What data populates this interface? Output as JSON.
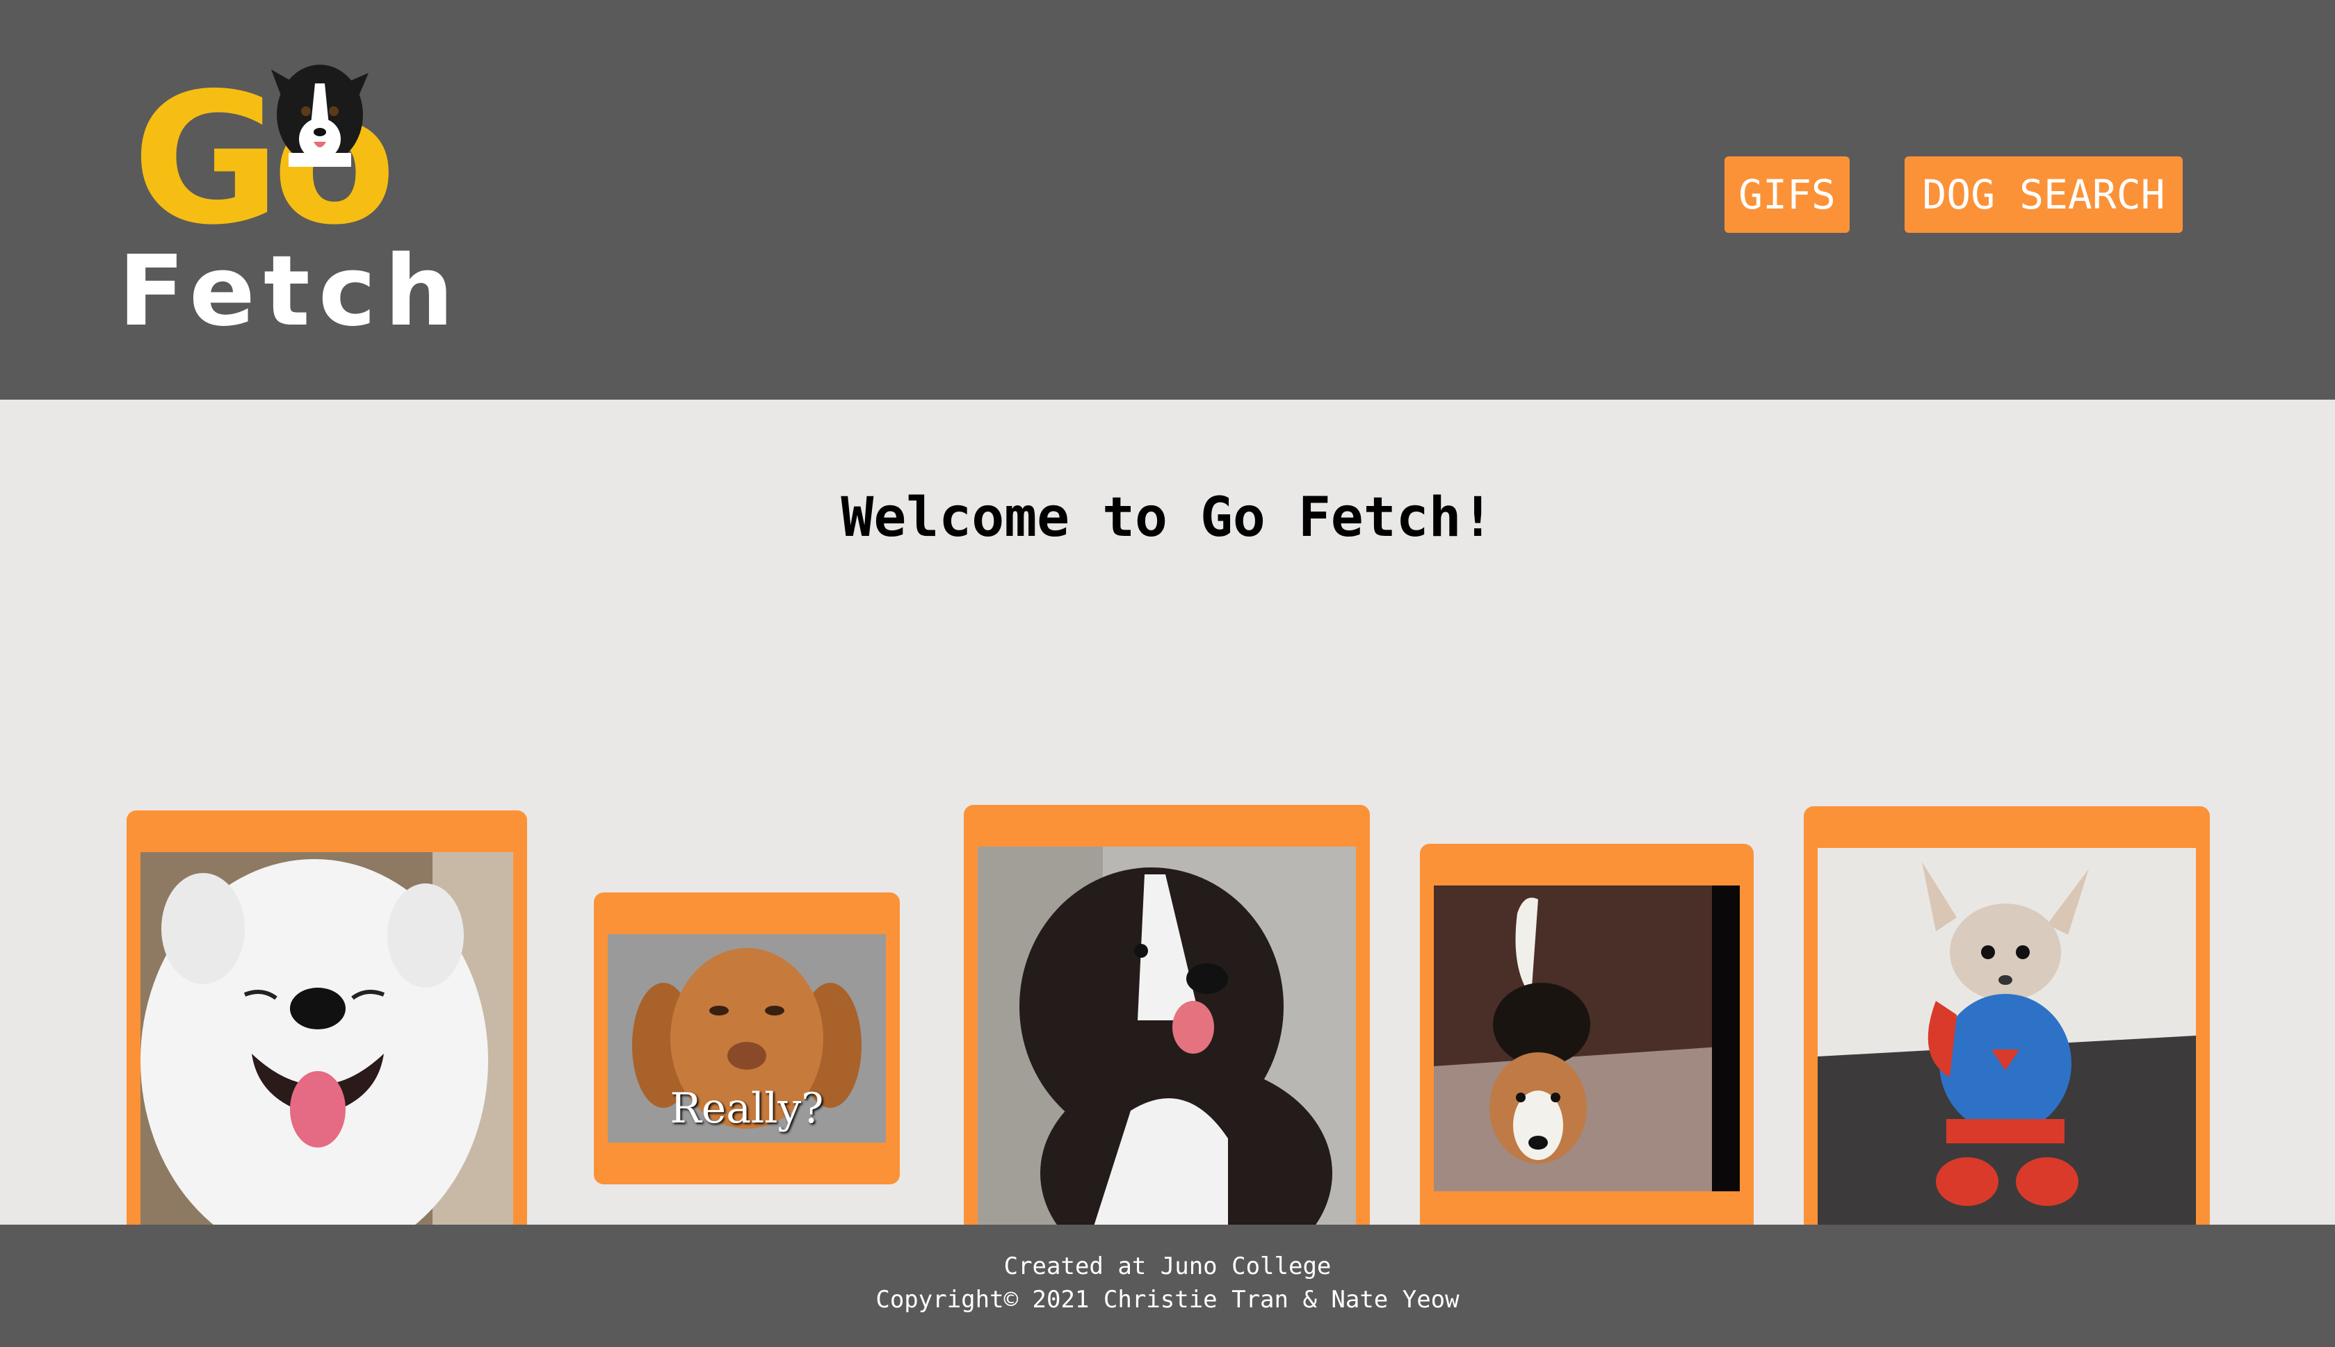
{
  "header": {
    "logo": {
      "word_top": "Go",
      "word_bottom": "Fetch",
      "color_go": "#f6be13",
      "color_fetch": "#ffffff"
    },
    "nav": [
      {
        "label": "GIFS"
      },
      {
        "label": "DOG SEARCH"
      }
    ],
    "background": "#5a5a5a",
    "button_color": "#fb9238"
  },
  "main": {
    "title": "Welcome to Go Fetch!",
    "cards": [
      {
        "name": "white fluffy dog smiling",
        "caption": ""
      },
      {
        "name": "brown puppy meme",
        "caption": "Really?"
      },
      {
        "name": "black and white dog",
        "caption": ""
      },
      {
        "name": "beagle peeking",
        "caption": ""
      },
      {
        "name": "chihuahua in superhero costume",
        "caption": ""
      }
    ]
  },
  "footer": {
    "line1": "Created at Juno College",
    "line2": "Copyright© 2021 Christie Tran & Nate Yeow"
  }
}
